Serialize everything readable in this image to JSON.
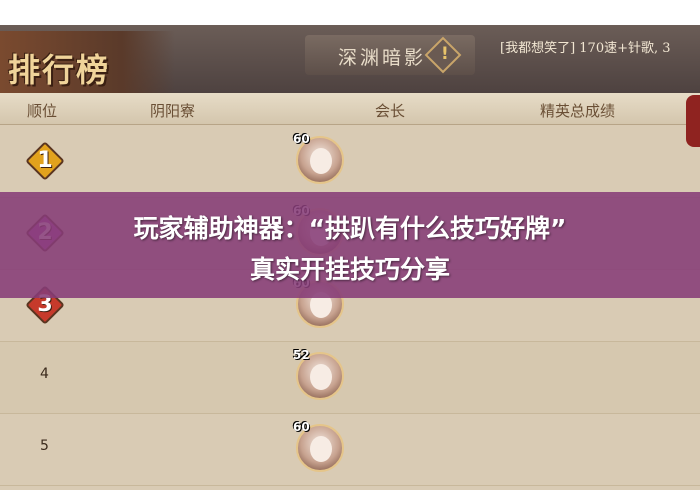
{
  "header": {
    "title": "排行榜",
    "guild_name": "深渊暗影",
    "chat_text": "[我都想笑了] 170速+针歌, 3"
  },
  "columns": [
    "顺位",
    "阴阳寮",
    "会长",
    "精英总成绩"
  ],
  "rows": [
    {
      "rank": "1",
      "style": "gold",
      "level": "60"
    },
    {
      "rank": "2",
      "style": "purple",
      "level": "60"
    },
    {
      "rank": "3",
      "style": "red",
      "level": "60"
    },
    {
      "rank": "4",
      "style": "plain",
      "level": "52"
    },
    {
      "rank": "5",
      "style": "plain",
      "level": "60"
    }
  ],
  "banner": {
    "line1": "玩家辅助神器：“拱趴有什么技巧好牌”",
    "line2": "真实开挂技巧分享"
  },
  "colors": {
    "rank1": "#e2a21d",
    "rank2": "#b256b5",
    "rank3": "#c63a2b",
    "banner": "#863c78"
  }
}
